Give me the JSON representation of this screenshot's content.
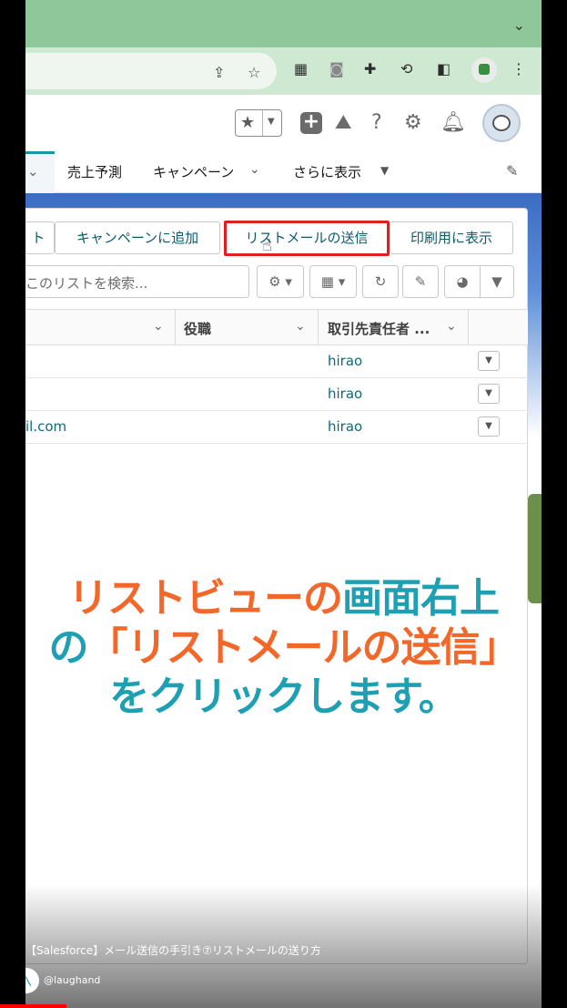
{
  "browser": {
    "icons": [
      "share-icon",
      "bookmark-star-icon",
      "qr-code-icon",
      "camera-icon",
      "extensions-puzzle-icon",
      "sync-icon",
      "sidepanel-icon",
      "profile-icon",
      "menu-kebab-icon"
    ]
  },
  "header": {
    "icons": [
      "favorites-star-icon",
      "add-icon",
      "trailhead-icon",
      "help-icon",
      "setup-gear-icon",
      "notifications-bell-icon",
      "user-avatar"
    ]
  },
  "nav": {
    "items": [
      "売上予測",
      "キャンペーン",
      "さらに表示"
    ]
  },
  "actions": {
    "buttons": [
      "ト",
      "キャンペーンに追加",
      "リストメールの送信",
      "印刷用に表示"
    ],
    "highlighted": "リストメールの送信"
  },
  "search": {
    "placeholder": "このリストを検索..."
  },
  "table": {
    "columns": [
      "役職",
      "取引先責任者 ..."
    ],
    "rows": [
      {
        "email": "",
        "owner": "hirao"
      },
      {
        "email": "",
        "owner": "hirao"
      },
      {
        "email": "il.com",
        "owner": "hirao"
      }
    ]
  },
  "caption": {
    "line1_orange": "リストビューの",
    "line1_teal": "画面右上",
    "line2_teal": "の",
    "line2_orange": "「リストメールの送信」",
    "line3_teal": "をクリックします。"
  },
  "video": {
    "title": "【Salesforce】メール送信の手引き⑦リストメールの送り方",
    "channel": "@laughand",
    "progress_percent": 16
  }
}
